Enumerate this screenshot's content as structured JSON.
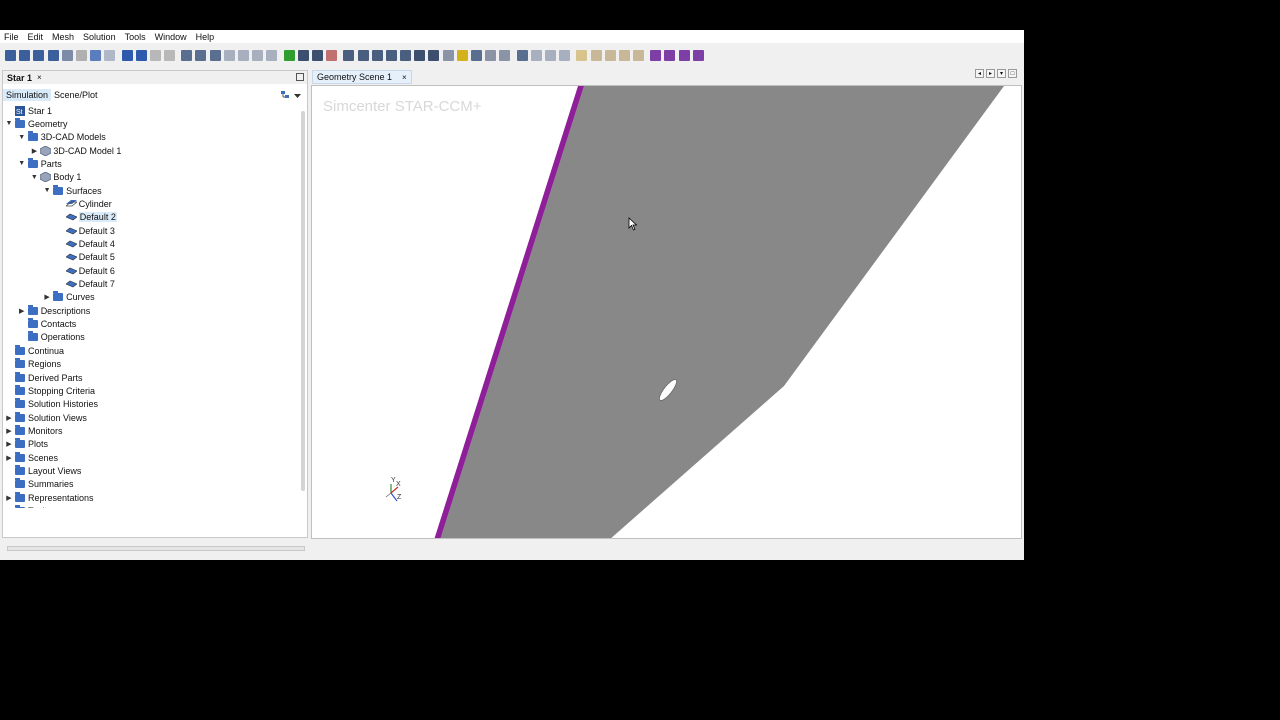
{
  "menu": [
    "File",
    "Edit",
    "Mesh",
    "Solution",
    "Tools",
    "Window",
    "Help"
  ],
  "toolbar_icons": [
    {
      "name": "new-simulation-icon",
      "color": "#3a5f9a"
    },
    {
      "name": "open-icon",
      "color": "#3a5f9a"
    },
    {
      "name": "save-icon",
      "color": "#3a5f9a"
    },
    {
      "name": "save-all-icon",
      "color": "#3a5f9a"
    },
    {
      "name": "copy-icon",
      "color": "#7c8ca8"
    },
    {
      "name": "delete-icon",
      "color": "#b0b0b0"
    },
    {
      "name": "undo-icon",
      "color": "#5a7dbd"
    },
    {
      "name": "redo-icon",
      "color": "#b0b8c8"
    },
    {
      "name": "sep",
      "color": ""
    },
    {
      "name": "run-icon",
      "color": "#2e5aac"
    },
    {
      "name": "step-icon",
      "color": "#2e5aac"
    },
    {
      "name": "pause-icon",
      "color": "#b8b8b8"
    },
    {
      "name": "stop-icon",
      "color": "#b8b8b8"
    },
    {
      "name": "sep",
      "color": ""
    },
    {
      "name": "mesh-icon",
      "color": "#5a6f90"
    },
    {
      "name": "filter-icon",
      "color": "#5a6f90"
    },
    {
      "name": "mesh-operation-icon",
      "color": "#5a6f90"
    },
    {
      "name": "surface-mesh-icon",
      "color": "#a8b0c0"
    },
    {
      "name": "volume-mesh-icon",
      "color": "#a8b0c0"
    },
    {
      "name": "clear-mesh-icon",
      "color": "#a8b0c0"
    },
    {
      "name": "generate-mesh-icon",
      "color": "#a8b0c0"
    },
    {
      "name": "sep",
      "color": ""
    },
    {
      "name": "initialize-icon",
      "color": "#2f9e2f"
    },
    {
      "name": "run-solver-icon",
      "color": "#3c4f6e"
    },
    {
      "name": "step-solver-icon",
      "color": "#3c4f6e"
    },
    {
      "name": "stop-solver-icon",
      "color": "#c07070"
    },
    {
      "name": "sep",
      "color": ""
    },
    {
      "name": "new-scene-icon",
      "color": "#4a5f80"
    },
    {
      "name": "fit-view-icon",
      "color": "#4a5f80"
    },
    {
      "name": "zoom-box-icon",
      "color": "#4a5f80"
    },
    {
      "name": "select-icon",
      "color": "#4a5f80"
    },
    {
      "name": "screenshot-icon",
      "color": "#4a5f80"
    },
    {
      "name": "back-icon",
      "color": "#3c4f6e"
    },
    {
      "name": "forward-icon",
      "color": "#3c4f6e"
    },
    {
      "name": "rotate-icon",
      "color": "#8a94a6"
    },
    {
      "name": "link-views-icon",
      "color": "#d4b21c"
    },
    {
      "name": "ruler-icon",
      "color": "#5a6f90"
    },
    {
      "name": "grid-icon",
      "color": "#8a94a6"
    },
    {
      "name": "table-icon",
      "color": "#8a94a6"
    },
    {
      "name": "sep",
      "color": ""
    },
    {
      "name": "transform-icon",
      "color": "#5a6f90"
    },
    {
      "name": "measure-icon",
      "color": "#a8b0c0"
    },
    {
      "name": "probe-icon",
      "color": "#a8b0c0"
    },
    {
      "name": "lasso-icon",
      "color": "#a8b0c0"
    },
    {
      "name": "sep",
      "color": ""
    },
    {
      "name": "play-icon",
      "color": "#d8c38c"
    },
    {
      "name": "record-icon",
      "color": "#c8b898"
    },
    {
      "name": "prev-frame-icon",
      "color": "#c8b898"
    },
    {
      "name": "next-frame-icon",
      "color": "#c8b898"
    },
    {
      "name": "animation-icon",
      "color": "#c8b898"
    },
    {
      "name": "sep",
      "color": ""
    },
    {
      "name": "layout-icon",
      "color": "#7d3fa6"
    },
    {
      "name": "split-layout-icon",
      "color": "#7d3fa6"
    },
    {
      "name": "window-layout-icon",
      "color": "#7d3fa6"
    },
    {
      "name": "layout-dropdown-icon",
      "color": "#7d3fa6"
    }
  ],
  "left_panel": {
    "doc_tab": "Star 1",
    "subtabs": [
      "Simulation",
      "Scene/Plot"
    ]
  },
  "tree": [
    {
      "label": "Star 1",
      "level": 0,
      "tw": "",
      "icon": "star-icon",
      "selected": false
    },
    {
      "label": "Geometry",
      "level": 0,
      "tw": "down",
      "icon": "folder",
      "selected": false
    },
    {
      "label": "3D-CAD Models",
      "level": 1,
      "tw": "down",
      "icon": "folder",
      "selected": false
    },
    {
      "label": "3D-CAD Model 1",
      "level": 2,
      "tw": "right",
      "icon": "cad-model-icon",
      "selected": false
    },
    {
      "label": "Parts",
      "level": 1,
      "tw": "down",
      "icon": "folder",
      "selected": false
    },
    {
      "label": "Body 1",
      "level": 2,
      "tw": "down",
      "icon": "body-icon",
      "selected": false
    },
    {
      "label": "Surfaces",
      "level": 3,
      "tw": "down",
      "icon": "folder",
      "selected": false
    },
    {
      "label": "Cylinder",
      "level": 4,
      "tw": "",
      "icon": "cylinder-surface-icon",
      "selected": false
    },
    {
      "label": "Default 2",
      "level": 4,
      "tw": "",
      "icon": "surface-icon",
      "selected": true
    },
    {
      "label": "Default 3",
      "level": 4,
      "tw": "",
      "icon": "surface-icon",
      "selected": false
    },
    {
      "label": "Default 4",
      "level": 4,
      "tw": "",
      "icon": "surface-icon",
      "selected": false
    },
    {
      "label": "Default 5",
      "level": 4,
      "tw": "",
      "icon": "surface-icon",
      "selected": false
    },
    {
      "label": "Default 6",
      "level": 4,
      "tw": "",
      "icon": "surface-icon",
      "selected": false
    },
    {
      "label": "Default 7",
      "level": 4,
      "tw": "",
      "icon": "surface-icon",
      "selected": false
    },
    {
      "label": "Curves",
      "level": 3,
      "tw": "right",
      "icon": "folder",
      "selected": false
    },
    {
      "label": "Descriptions",
      "level": 1,
      "tw": "right",
      "icon": "folder",
      "selected": false
    },
    {
      "label": "Contacts",
      "level": 1,
      "tw": "",
      "icon": "folder",
      "selected": false
    },
    {
      "label": "Operations",
      "level": 1,
      "tw": "",
      "icon": "folder",
      "selected": false
    },
    {
      "label": "Continua",
      "level": 0,
      "tw": "",
      "icon": "folder",
      "selected": false
    },
    {
      "label": "Regions",
      "level": 0,
      "tw": "",
      "icon": "folder",
      "selected": false
    },
    {
      "label": "Derived Parts",
      "level": 0,
      "tw": "",
      "icon": "folder",
      "selected": false
    },
    {
      "label": "Stopping Criteria",
      "level": 0,
      "tw": "",
      "icon": "folder",
      "selected": false
    },
    {
      "label": "Solution Histories",
      "level": 0,
      "tw": "",
      "icon": "folder",
      "selected": false
    },
    {
      "label": "Solution Views",
      "level": 0,
      "tw": "right",
      "icon": "folder",
      "selected": false
    },
    {
      "label": "Monitors",
      "level": 0,
      "tw": "right",
      "icon": "folder",
      "selected": false
    },
    {
      "label": "Plots",
      "level": 0,
      "tw": "right",
      "icon": "folder",
      "selected": false
    },
    {
      "label": "Scenes",
      "level": 0,
      "tw": "right",
      "icon": "folder",
      "selected": false
    },
    {
      "label": "Layout Views",
      "level": 0,
      "tw": "",
      "icon": "folder",
      "selected": false
    },
    {
      "label": "Summaries",
      "level": 0,
      "tw": "",
      "icon": "folder",
      "selected": false
    },
    {
      "label": "Representations",
      "level": 0,
      "tw": "right",
      "icon": "folder",
      "selected": false
    },
    {
      "label": "Tools",
      "level": 0,
      "tw": "right",
      "icon": "folder",
      "selected": false
    }
  ],
  "scene": {
    "tab_title": "Geometry Scene 1",
    "watermark": "Simcenter STAR-CCM+",
    "axes": {
      "x": "X",
      "y": "Y",
      "z": "Z"
    },
    "colors": {
      "surface": "#888888",
      "edge": "#8e1f98",
      "background": "#ffffff"
    }
  }
}
